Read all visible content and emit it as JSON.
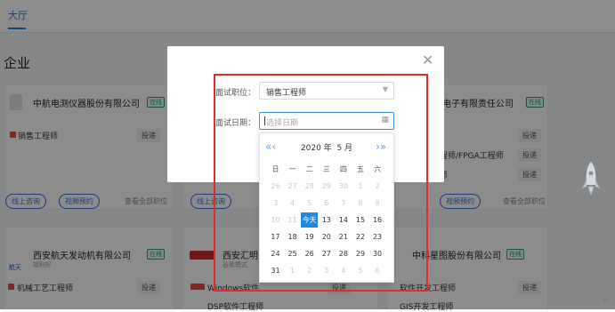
{
  "topbar": {
    "tab": "大厅"
  },
  "section_title": "企业",
  "cards": {
    "c1": {
      "name": "中航电测仪器股份有限公司",
      "status": "在线",
      "job": "销售工程师",
      "apply": "投递"
    },
    "c3": {
      "name": "电子有限责任公司",
      "status": "在线",
      "jobs": [
        "",
        "程师/FPGA工程师",
        "师"
      ],
      "apply": "投递"
    },
    "row1_actions": {
      "consult": "线上咨询",
      "video": "视频预约",
      "all": "查看全部职位"
    },
    "c4": {
      "name": "西安航天发动机有限公司",
      "status": "在线",
      "sub": "福利好",
      "job": "机械工艺工程师",
      "apply": "投递",
      "logo": "航天"
    },
    "c5": {
      "name": "西安汇明",
      "sub": "谷歌模式",
      "job": "Windows软件",
      "apply": "投递",
      "job2": "DSP软件工程师"
    },
    "c6": {
      "name": "中科星图股份有限公司",
      "status": "在线",
      "job": "软件开发工程师",
      "apply": "投递",
      "job2": "GIS开发工程师"
    }
  },
  "modal": {
    "position_label": "面试职位：",
    "position_value": "销售工程师",
    "date_label": "面试日期：",
    "date_placeholder": "选择日期"
  },
  "picker": {
    "prev": "«‹",
    "next": "›»",
    "year": "2020 年",
    "month": "5 月",
    "weekdays": [
      "日",
      "一",
      "二",
      "三",
      "四",
      "五",
      "六"
    ],
    "today_label": "今天",
    "weeks": [
      [
        "26",
        "27",
        "28",
        "29",
        "30",
        "1",
        "2"
      ],
      [
        "3",
        "4",
        "5",
        "6",
        "7",
        "8",
        "9"
      ],
      [
        "10",
        "11",
        "今天",
        "13",
        "14",
        "15",
        "16"
      ],
      [
        "17",
        "18",
        "19",
        "20",
        "21",
        "22",
        "23"
      ],
      [
        "24",
        "25",
        "26",
        "27",
        "28",
        "29",
        "30"
      ],
      [
        "31",
        "1",
        "2",
        "3",
        "4",
        "5",
        "6"
      ]
    ],
    "disabled": [
      [
        true,
        true,
        true,
        true,
        true,
        true,
        true
      ],
      [
        true,
        true,
        true,
        true,
        true,
        true,
        true
      ],
      [
        true,
        true,
        false,
        false,
        false,
        false,
        false
      ],
      [
        false,
        false,
        false,
        false,
        false,
        false,
        false
      ],
      [
        false,
        false,
        false,
        false,
        false,
        false,
        false
      ],
      [
        false,
        true,
        true,
        true,
        true,
        true,
        true
      ]
    ]
  },
  "colors": {
    "accent": "#1e88e5",
    "highlight_box": "#e22b2b",
    "online": "#22a06b"
  },
  "return_mark": "↵"
}
